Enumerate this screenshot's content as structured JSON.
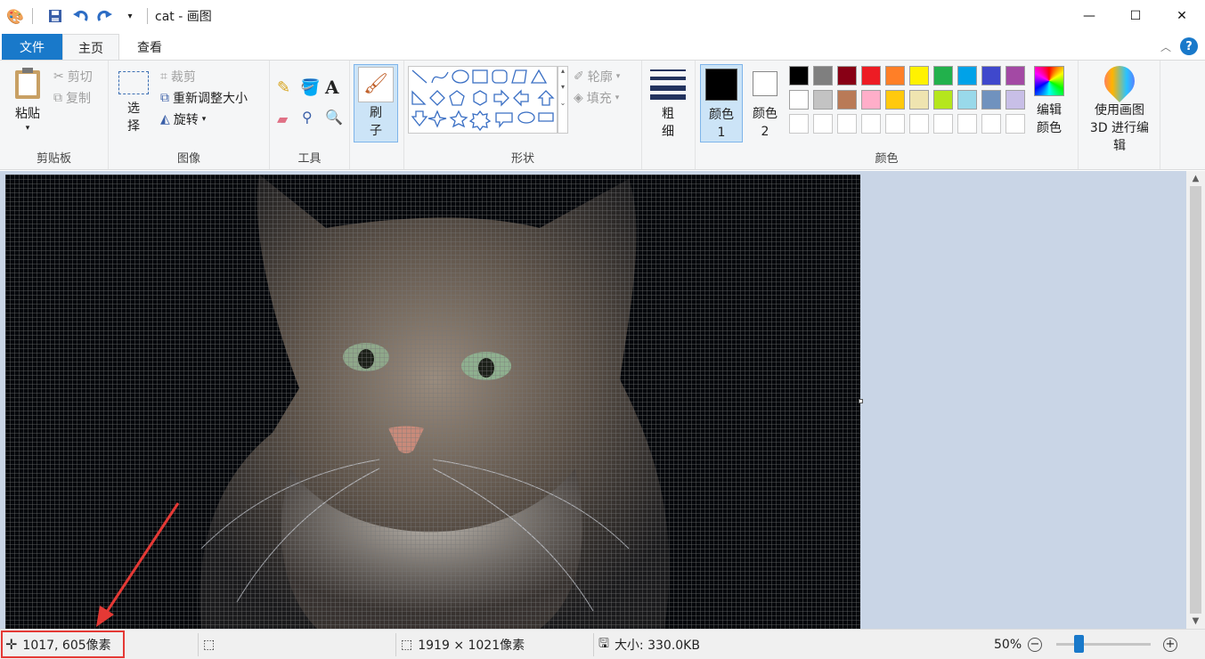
{
  "titlebar": {
    "title": "cat - 画图"
  },
  "tabs": {
    "file": "文件",
    "home": "主页",
    "view": "查看"
  },
  "clipboard": {
    "paste": "粘贴",
    "cut": "剪切",
    "copy": "复制",
    "label": "剪贴板"
  },
  "image": {
    "select": "选择",
    "crop": "裁剪",
    "resize": "重新调整大小",
    "rotate": "旋转",
    "label": "图像"
  },
  "tools": {
    "label": "工具"
  },
  "brushes": {
    "label": "刷子"
  },
  "shapes": {
    "outline": "轮廓",
    "fill": "填充",
    "label": "形状"
  },
  "size": {
    "label": "粗细"
  },
  "colors": {
    "color1": "颜色 1",
    "color2": "颜色 2",
    "edit": "编辑颜色",
    "label": "颜色",
    "color1_value": "#000000",
    "color2_value": "#ffffff",
    "palette_row1": [
      "#000000",
      "#7f7f7f",
      "#880015",
      "#ed1c24",
      "#ff7f27",
      "#fff200",
      "#22b14c",
      "#00a2e8",
      "#3f48cc",
      "#a349a4"
    ],
    "palette_row2": [
      "#ffffff",
      "#c3c3c3",
      "#b97a57",
      "#ffaec9",
      "#ffc90e",
      "#efe4b0",
      "#b5e61d",
      "#99d9ea",
      "#7092be",
      "#c8bfe7"
    ]
  },
  "paint3d": {
    "label": "使用画图 3D 进行编辑"
  },
  "status": {
    "coords": "1017, 605像素",
    "dimensions": "1919 × 1021像素",
    "size": "大小: 330.0KB",
    "zoom": "50%"
  }
}
